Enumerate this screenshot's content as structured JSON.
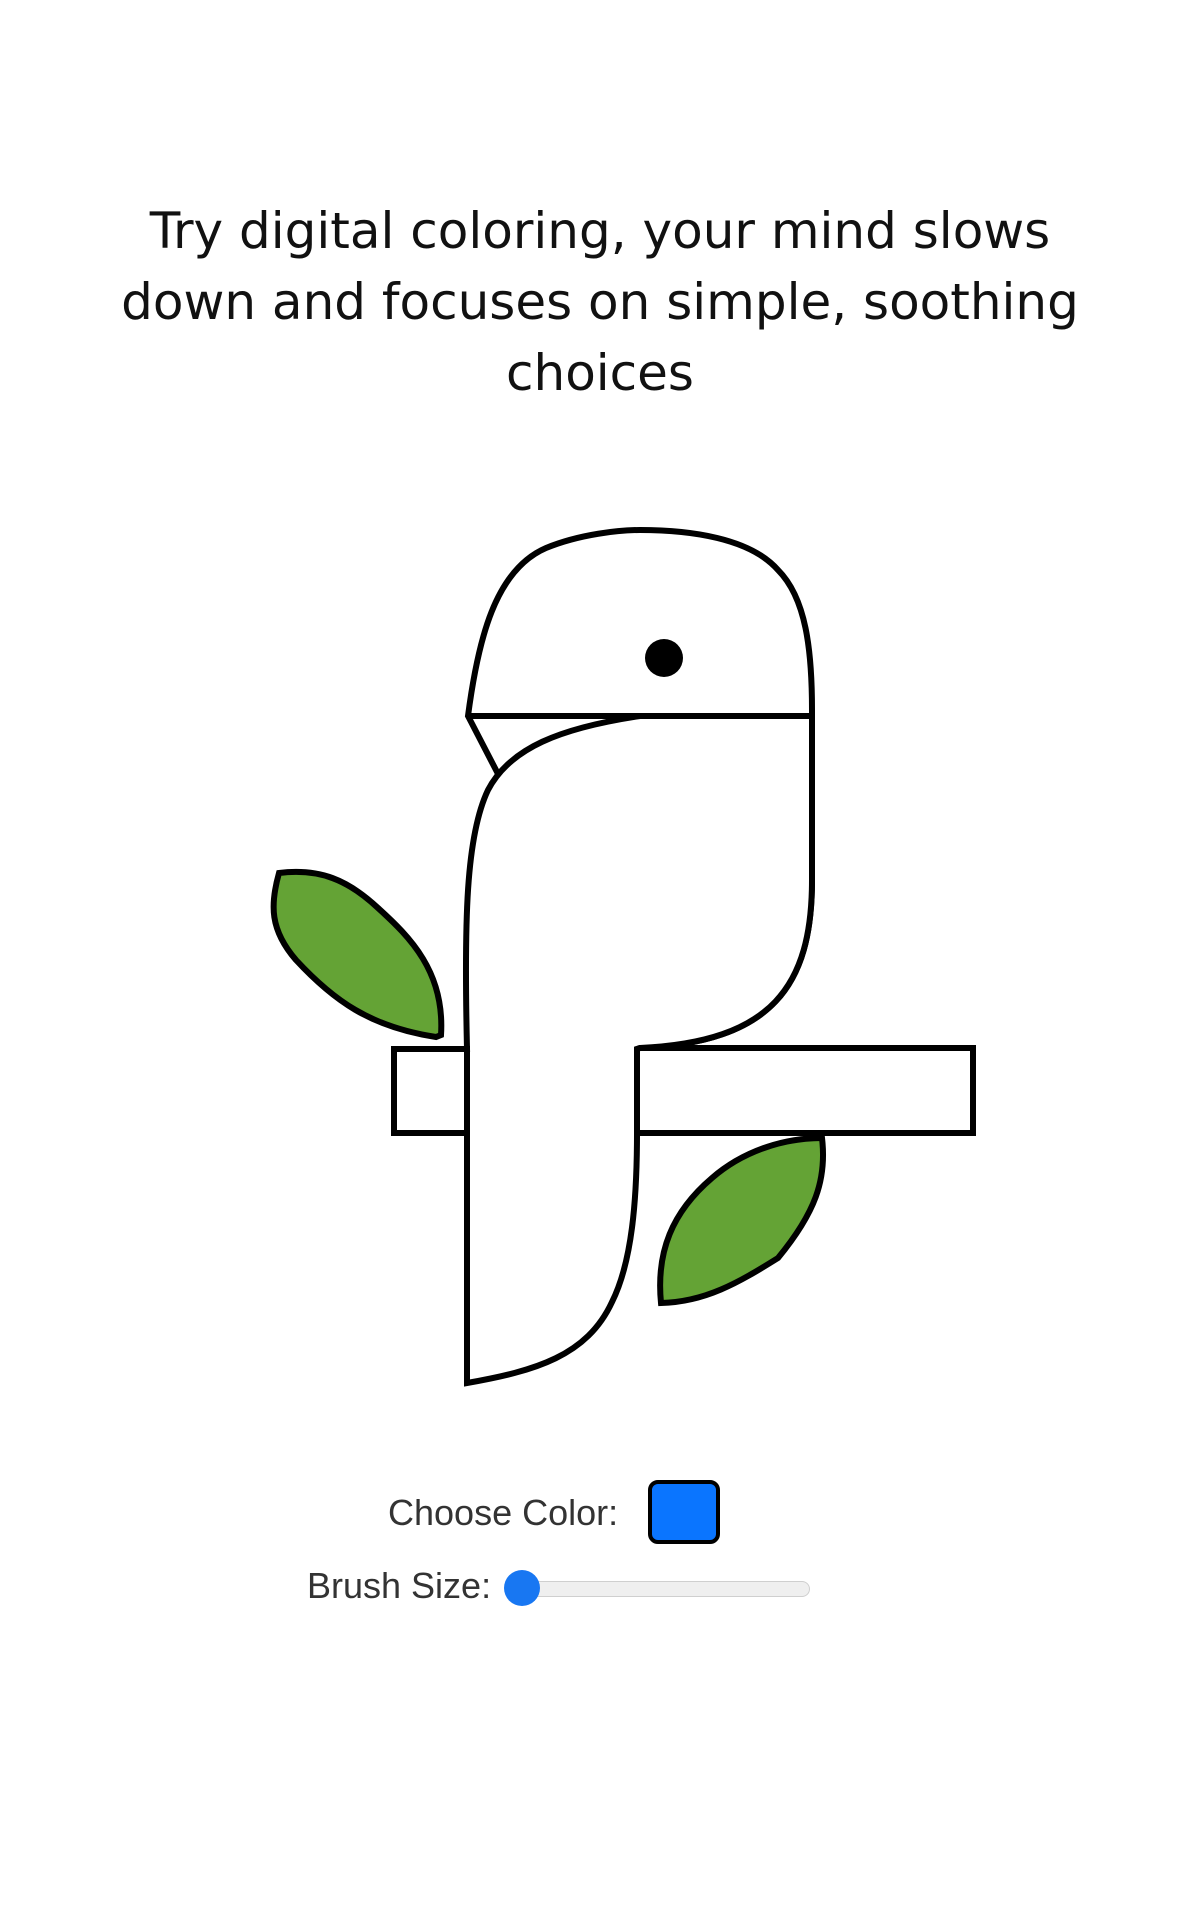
{
  "headline": "Try digital coloring, your mind slows down and focuses on simple, soothing choices",
  "drawing": {
    "stroke_color": "#000000",
    "fill_color": "#ffffff",
    "leaf_color": "#64A335",
    "eye_color": "#000000"
  },
  "controls": {
    "color_label": "Choose Color:",
    "selected_color": "#0A75FF",
    "brush_label": "Brush Size:",
    "brush_size": 0,
    "brush_accent": "#1877F2"
  }
}
